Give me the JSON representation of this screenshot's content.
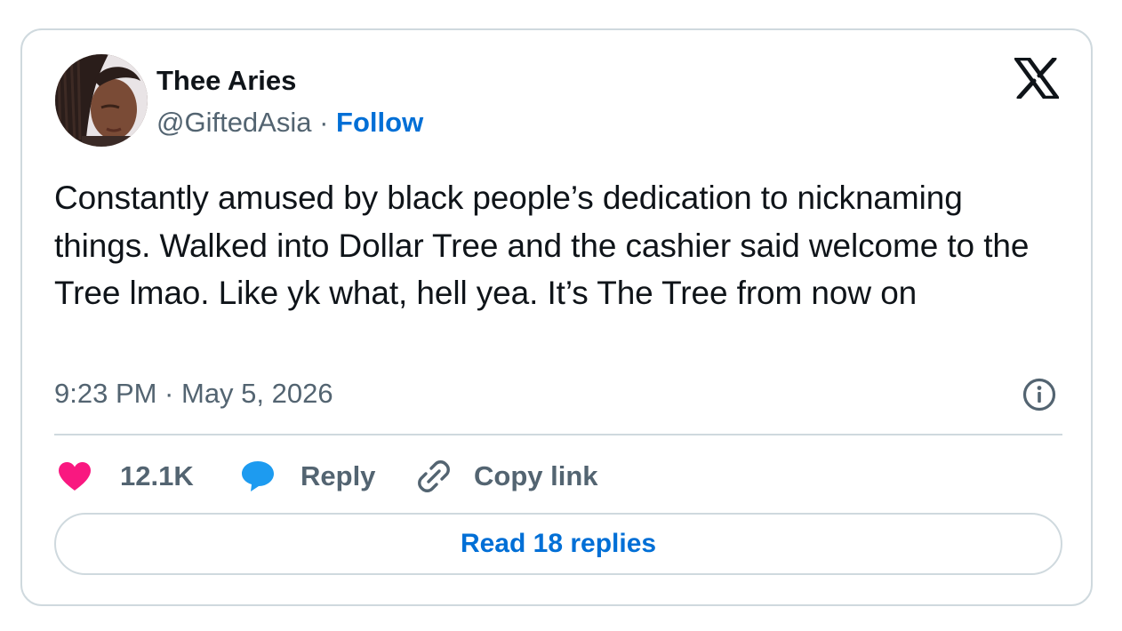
{
  "author": {
    "name": "Thee Aries",
    "handle": "@GiftedAsia",
    "separator": " · ",
    "follow_label": "Follow"
  },
  "tweet": {
    "text": "Constantly amused by black people’s dedication to nicknaming things. Walked into Dollar Tree and the cashier said welcome to the Tree lmao. Like yk what, hell yea. It’s The Tree from now on",
    "timestamp": "9:23 PM · May 5, 2026"
  },
  "actions": {
    "like_count": "12.1K",
    "reply_label": "Reply",
    "copy_link_label": "Copy link"
  },
  "footer": {
    "read_replies_label": "Read 18 replies"
  },
  "icons": {
    "like": "heart-icon",
    "reply": "speech-bubble-icon",
    "copy": "link-icon",
    "info": "info-icon",
    "brand": "x-logo-icon"
  },
  "colors": {
    "like": "#f91880",
    "reply": "#1d9bf0",
    "link": "#006fd6",
    "muted": "#536471",
    "border": "#cfd9de"
  }
}
